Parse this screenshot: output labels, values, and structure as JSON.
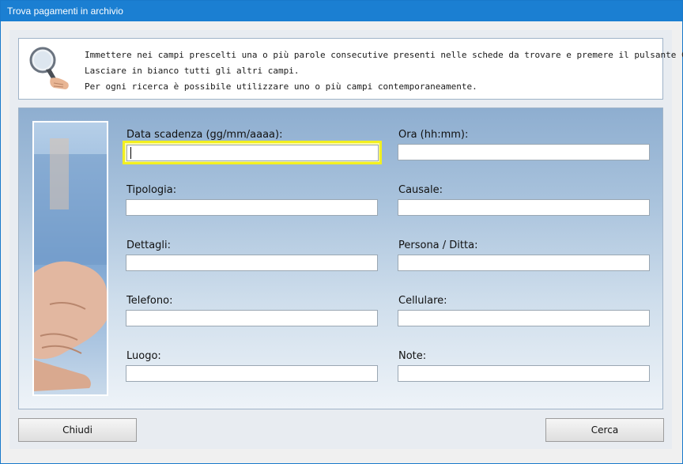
{
  "window": {
    "title": "Trova pagamenti in archivio"
  },
  "info": {
    "lines": [
      "Immettere nei campi prescelti una o più parole consecutive presenti nelle schede da trovare e premere il pulsante Cerca.",
      "Lasciare in bianco tutti gli altri campi.",
      "Per ogni ricerca è possibile utilizzare uno o più campi contemporaneamente."
    ]
  },
  "fields": {
    "data_scadenza": {
      "label": "Data scadenza (gg/mm/aaaa):",
      "value": ""
    },
    "ora": {
      "label": "Ora (hh:mm):",
      "value": ""
    },
    "tipologia": {
      "label": "Tipologia:",
      "value": ""
    },
    "causale": {
      "label": "Causale:",
      "value": ""
    },
    "dettagli": {
      "label": "Dettagli:",
      "value": ""
    },
    "persona_ditta": {
      "label": "Persona / Ditta:",
      "value": ""
    },
    "telefono": {
      "label": "Telefono:",
      "value": ""
    },
    "cellulare": {
      "label": "Cellulare:",
      "value": ""
    },
    "luogo": {
      "label": "Luogo:",
      "value": ""
    },
    "note": {
      "label": "Note:",
      "value": ""
    }
  },
  "buttons": {
    "close": "Chiudi",
    "search": "Cerca"
  },
  "colors": {
    "titlebar": "#1b7fd2",
    "focus": "#f2f020"
  },
  "icons": {
    "info": "magnifier-icon",
    "photo": "handshake-image"
  }
}
